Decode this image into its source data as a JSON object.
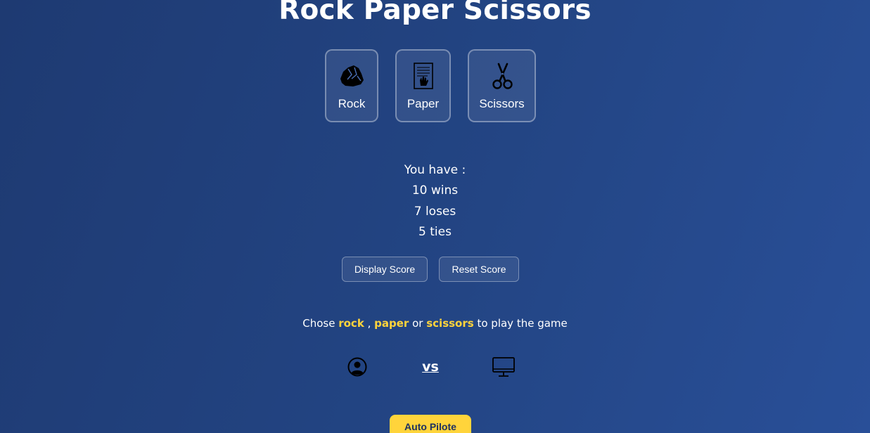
{
  "title": "Rock Paper Scissors",
  "choices": {
    "rock": {
      "label": "Rock",
      "icon": "rock-icon"
    },
    "paper": {
      "label": "Paper",
      "icon": "paper-icon"
    },
    "scissors": {
      "label": "Scissors",
      "icon": "scissors-icon"
    }
  },
  "score": {
    "intro": "You have :",
    "wins": "10 wins",
    "loses": "7 loses",
    "ties": "5 ties"
  },
  "actions": {
    "display_label": "Display Score",
    "reset_label": "Reset Score"
  },
  "instruction": {
    "prefix": "Chose",
    "rock": "rock",
    "sep1": ",",
    "paper": "paper",
    "or": "or",
    "scissors": "scissors",
    "suffix": "to play the game"
  },
  "matchup": {
    "player_icon": "user-circle-icon",
    "vs": "vs",
    "computer_icon": "computer-monitor-icon"
  },
  "auto_pilot_label": "Auto Pilote",
  "colors": {
    "background_start": "#1e3a72",
    "background_end": "#294f98",
    "highlight": "#ffd43b",
    "text": "#ffffff"
  }
}
